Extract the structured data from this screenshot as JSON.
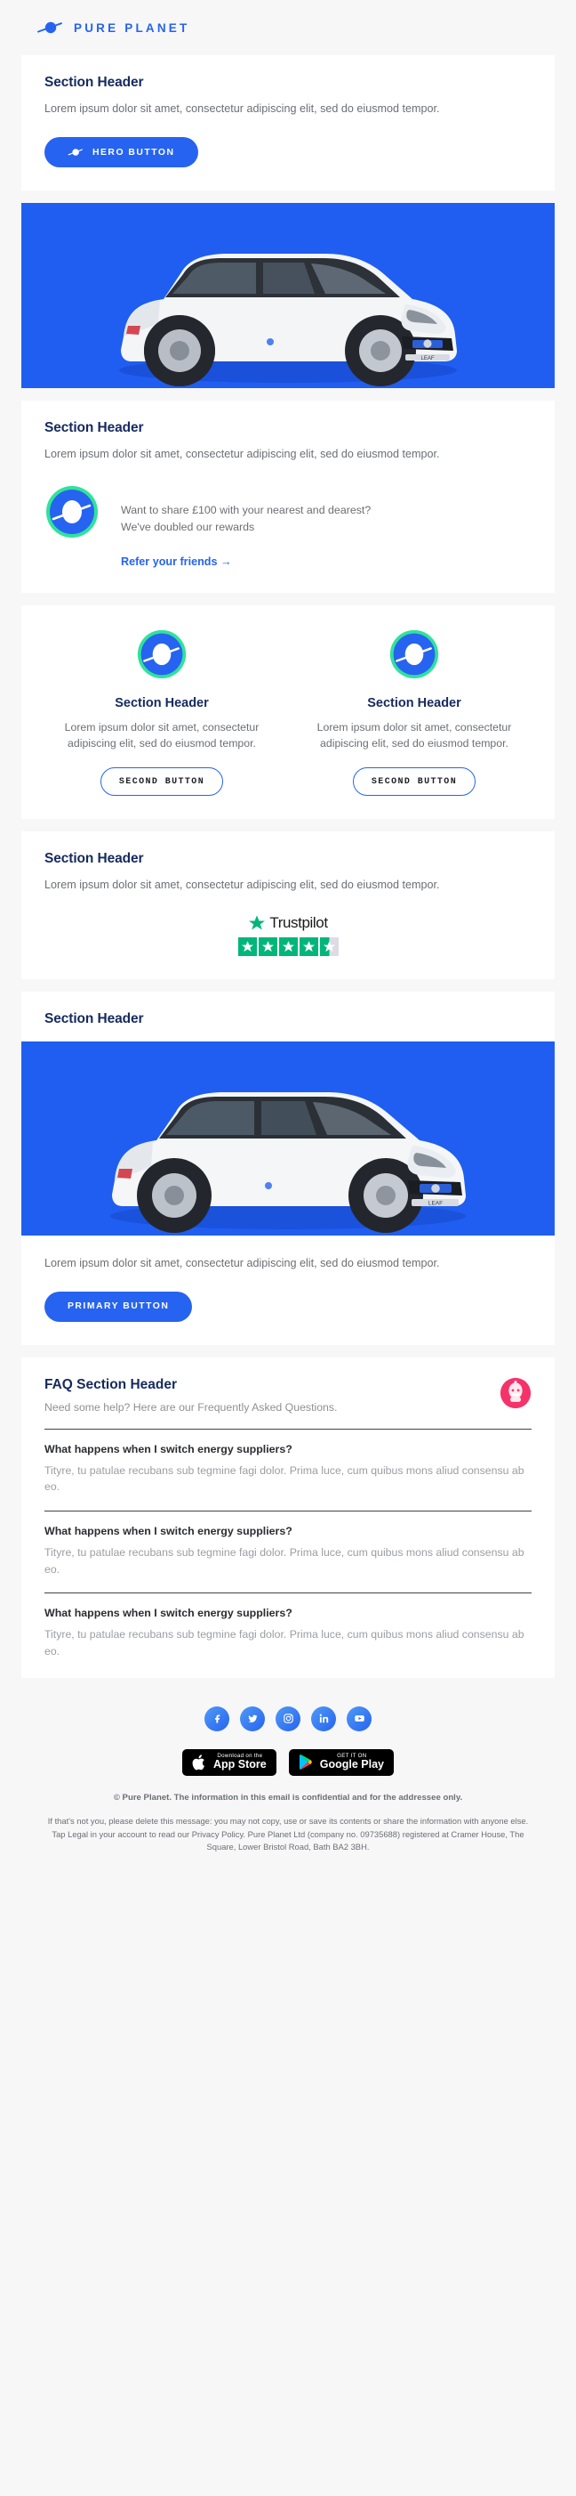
{
  "brand": {
    "name": "PURE PLANET",
    "logo_icon": "planet-icon",
    "accent": "#2663F0",
    "navy": "#152a5e",
    "green_ring": "#2fe39a"
  },
  "hero": {
    "title": "Section Header",
    "body": "Lorem ipsum dolor sit amet, consectetur adipiscing elit, sed do eiusmod tempor.",
    "button_label": "HERO BUTTON",
    "button_icon": "planet-icon",
    "image_alt": "white-electric-car-photo"
  },
  "referral": {
    "title": "Section Header",
    "body": "Lorem ipsum dolor sit amet, consectetur adipiscing elit, sed do eiusmod tempor.",
    "icon": "planet-badge-icon",
    "promo_line_1": "Want to share £100 with your nearest and dearest?",
    "promo_line_2": "We've doubled our rewards",
    "link_label": "Refer your friends →"
  },
  "two_column": {
    "columns": [
      {
        "icon": "planet-badge-icon",
        "title": "Section Header",
        "body": "Lorem ipsum dolor sit amet, consectetur adipiscing elit, sed do eiusmod tempor.",
        "button_label": "SECOND BUTTON"
      },
      {
        "icon": "planet-badge-icon",
        "title": "Section Header",
        "body": "Lorem ipsum dolor sit amet, consectetur adipiscing elit, sed do eiusmod tempor.",
        "button_label": "SECOND BUTTON"
      }
    ]
  },
  "trustpilot": {
    "title": "Section Header",
    "body": "Lorem ipsum dolor sit amet, consectetur adipiscing elit, sed do eiusmod tempor.",
    "logo_word": "Trustpilot",
    "logo_icon": "trustpilot-star-icon",
    "rating_stars": 4.5,
    "star_color": "#00b67a",
    "star_empty_color": "#dcdce6"
  },
  "promo": {
    "title": "Section Header",
    "image_alt": "white-electric-car-photo",
    "body": "Lorem ipsum dolor sit amet, consectetur adipiscing elit, sed do eiusmod tempor.",
    "button_label": "PRIMARY BUTTON"
  },
  "faq": {
    "title": "FAQ Section Header",
    "subtitle": "Need some help? Here are our Frequently Asked Questions.",
    "avatar_icon": "robot-avatar-icon",
    "avatar_color": "#f5336b",
    "items": [
      {
        "question": "What happens when I switch energy suppliers?",
        "answer": "Tityre, tu patulae recubans sub tegmine fagi dolor. Prima luce, cum quibus mons aliud consensu ab eo."
      },
      {
        "question": "What happens when I switch energy suppliers?",
        "answer": "Tityre, tu patulae recubans sub tegmine fagi dolor. Prima luce, cum quibus mons aliud consensu ab eo."
      },
      {
        "question": "What happens when I switch energy suppliers?",
        "answer": "Tityre, tu patulae recubans sub tegmine fagi dolor. Prima luce, cum quibus mons aliud consensu ab eo."
      }
    ]
  },
  "footer": {
    "social": [
      {
        "name": "facebook-icon",
        "glyph": "f"
      },
      {
        "name": "twitter-icon",
        "glyph": "t"
      },
      {
        "name": "instagram-icon",
        "glyph": "i"
      },
      {
        "name": "linkedin-icon",
        "glyph": "in"
      },
      {
        "name": "youtube-icon",
        "glyph": "y"
      }
    ],
    "app_store": {
      "small": "Download on the",
      "big": "App Store",
      "icon": "apple-icon"
    },
    "google_play": {
      "small": "GET IT ON",
      "big": "Google Play",
      "icon": "google-play-icon"
    },
    "copyright": "© Pure Planet. The information in this email is confidential and for the addressee only.",
    "legal": "If that's not you, please delete this message: you may not copy, use or save its contents or share the information with anyone else. Tap Legal in your account to read our Privacy Policy. Pure Planet Ltd (company no. 09735688) registered at Cramer House, The Square, Lower Bristol Road, Bath BA2 3BH."
  }
}
